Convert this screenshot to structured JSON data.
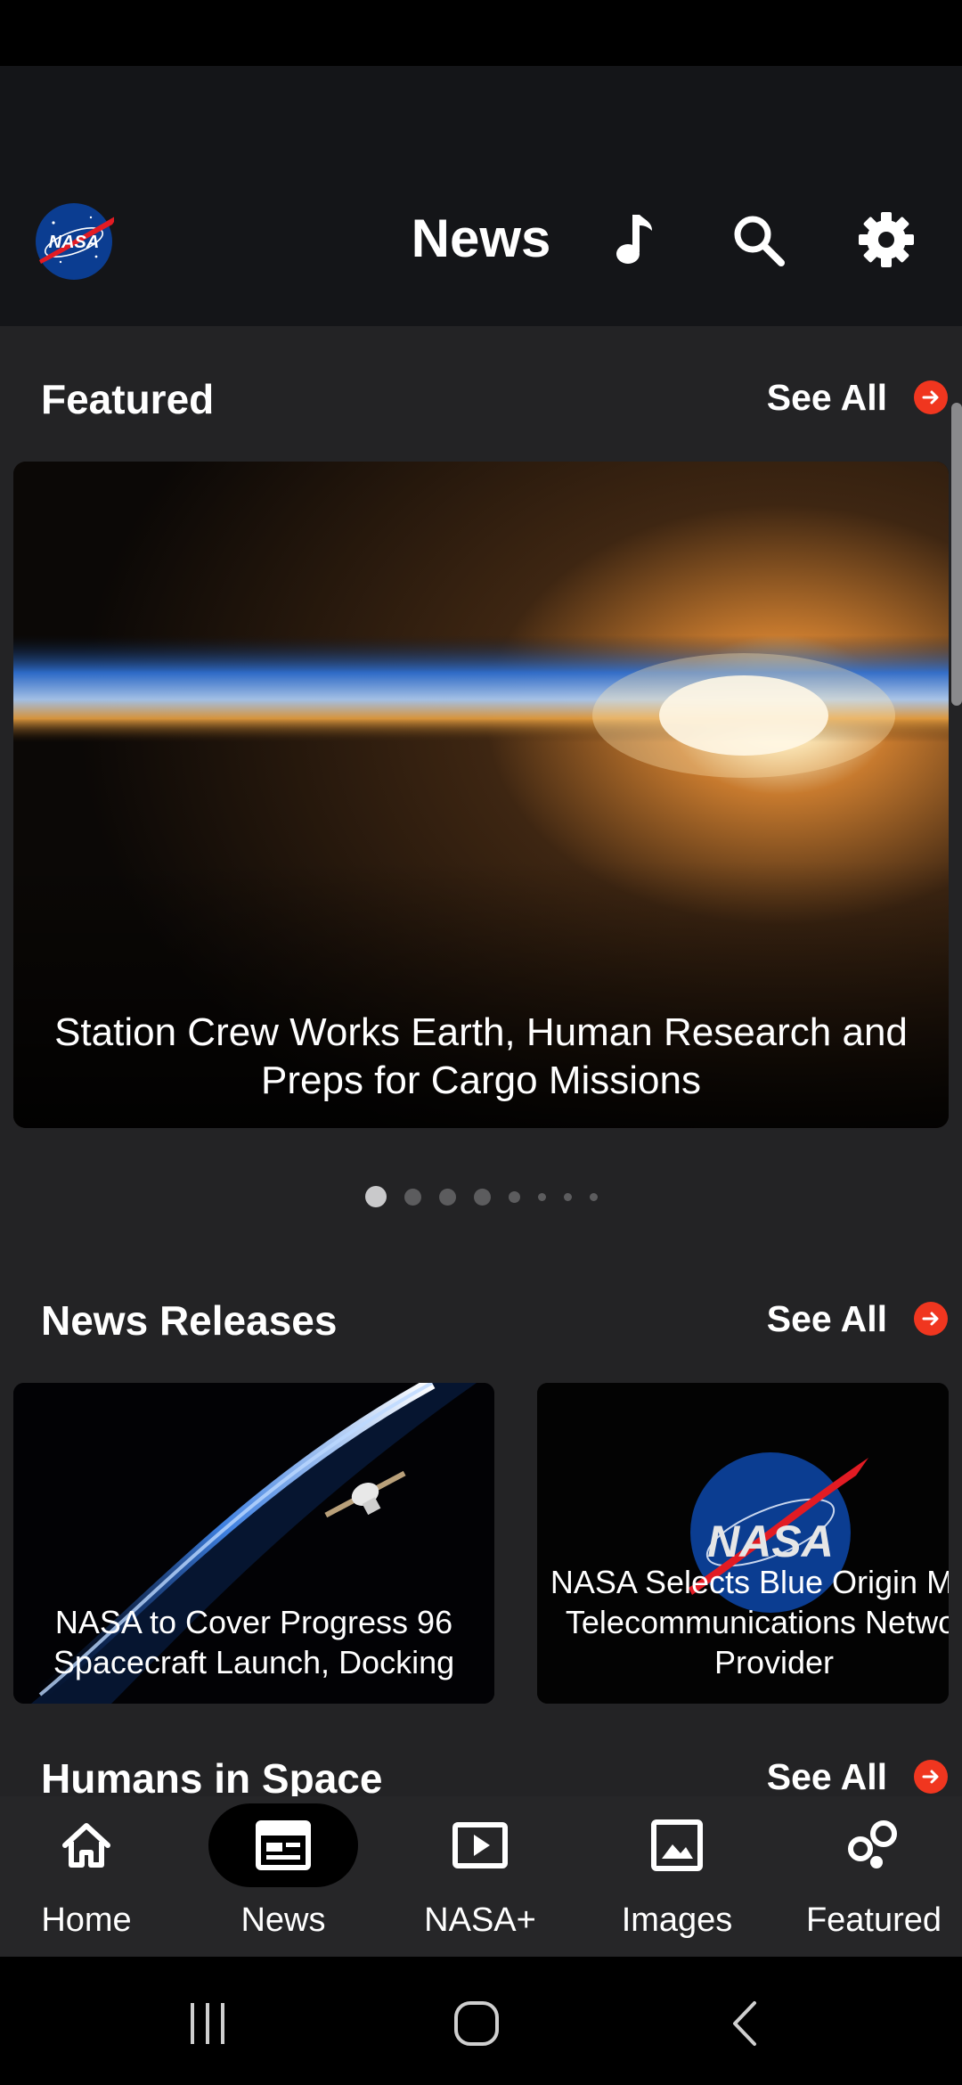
{
  "header": {
    "title": "News",
    "logo_text": "NASA",
    "music_icon": "music-note-icon",
    "search_icon": "search-icon",
    "settings_icon": "gear-icon"
  },
  "featured": {
    "title": "Featured",
    "see_all": "See All",
    "card_caption": "Station Crew Works Earth, Human Research and Preps for Cargo Missions",
    "carousel_position": 1,
    "carousel_count": 8
  },
  "news_releases": {
    "title": "News Releases",
    "see_all": "See All",
    "cards": [
      {
        "caption": "NASA to Cover Progress 96 Spacecraft Launch, Docking"
      },
      {
        "caption": "NASA Selects Blue Origin Mars Telecommunications Network Provider",
        "image_text": "NASA"
      }
    ]
  },
  "humans_in_space": {
    "title": "Humans in Space",
    "see_all": "See All"
  },
  "bottom_nav": {
    "items": [
      {
        "label": "Home",
        "icon": "home-icon",
        "active": false
      },
      {
        "label": "News",
        "icon": "news-icon",
        "active": true
      },
      {
        "label": "NASA+",
        "icon": "play-icon",
        "active": false
      },
      {
        "label": "Images",
        "icon": "image-icon",
        "active": false
      },
      {
        "label": "Featured",
        "icon": "featured-icon",
        "active": false
      }
    ]
  },
  "colors": {
    "accent": "#f0361f",
    "app_bar": "#141518",
    "content_bg": "#232325",
    "nav_bg": "#262628"
  }
}
